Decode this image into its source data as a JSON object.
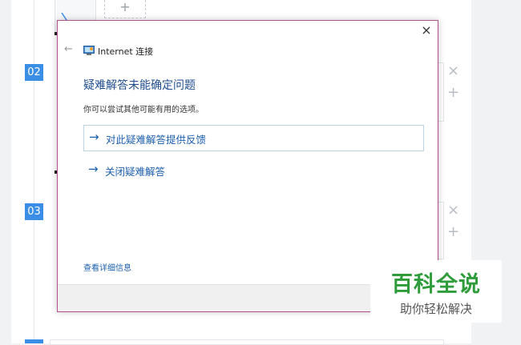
{
  "background": {
    "steps": [
      {
        "label": "02"
      },
      {
        "label": "03"
      }
    ],
    "card_close_glyph": "×",
    "card_add_glyph": "+",
    "thumb_add_glyph": "+"
  },
  "dialog": {
    "close_glyph": "×",
    "back_glyph": "←",
    "app_icon": "network-icon",
    "window_title": "Internet 连接",
    "heading": "疑难解答未能确定问题",
    "subtext": "你可以尝试其他可能有用的选项。",
    "options": [
      {
        "arrow": "→",
        "label": "对此疑难解答提供反馈"
      },
      {
        "arrow": "→",
        "label": "关闭疑难解答"
      }
    ],
    "details_link": "查看详细信息"
  },
  "watermark": {
    "title": "百科全说",
    "subtitle": "助你轻松解决"
  },
  "colors": {
    "accent": "#3a8ee6",
    "dialog_border": "#b3518f",
    "link": "#1b5fae",
    "heading": "#1f4d8f",
    "watermark_green": "#2e9c3a"
  }
}
